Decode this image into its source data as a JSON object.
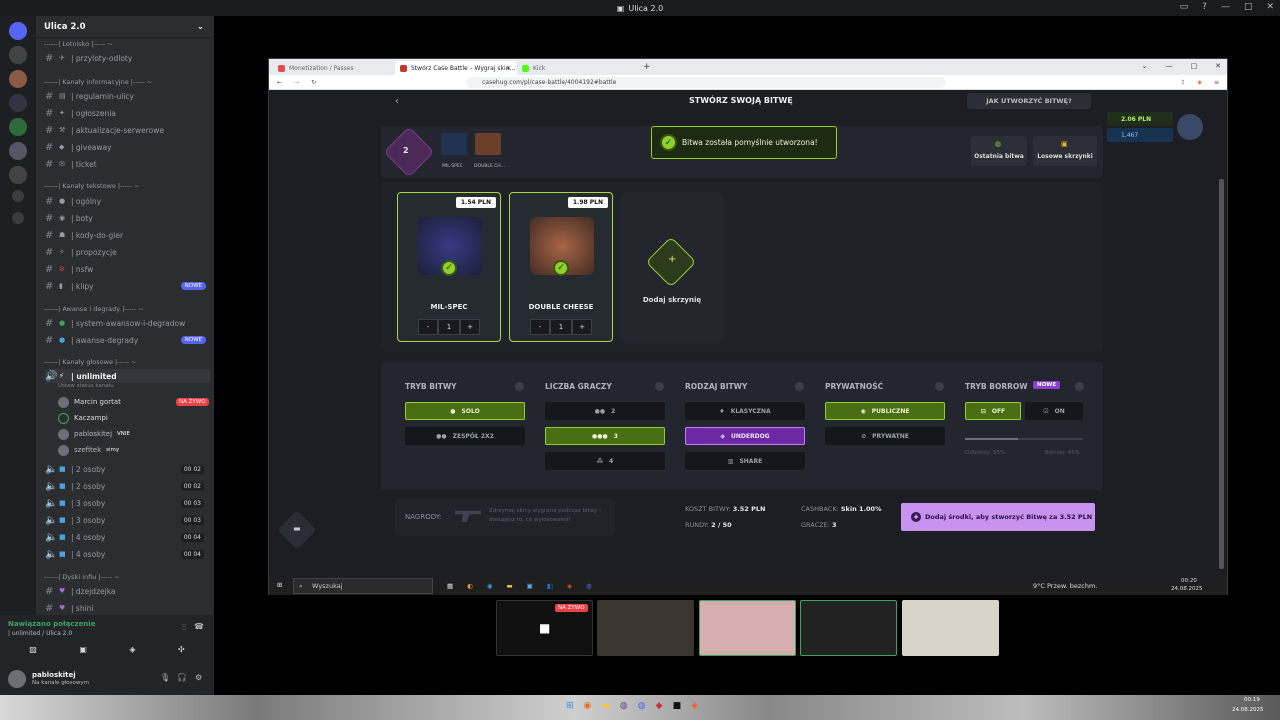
{
  "window": {
    "title": "Ulica 2.0"
  },
  "discord": {
    "server_name": "Ulica 2.0",
    "categories": [
      {
        "label": "------| Lotnisko |----- ~"
      },
      {
        "label": "------| Kanały informacyjne |----- ~"
      },
      {
        "label": "------| Kanały tekstowe |----- ~"
      },
      {
        "label": "------| Awanse i degrady |----- ~"
      },
      {
        "label": "------| Kanały głosowe |----- ~"
      },
      {
        "label": "------| Dyski infiu |----- ~"
      }
    ],
    "text_channels": [
      {
        "label": "| przyloty-odloty"
      },
      {
        "label": "| regulamin-ulicy"
      },
      {
        "label": "| ogłoszenia"
      },
      {
        "label": "| aktualizacje-serwerowe"
      },
      {
        "label": "| giveaway"
      },
      {
        "label": "| ticket"
      },
      {
        "label": "| ogólny"
      },
      {
        "label": "| boty"
      },
      {
        "label": "| kody-do-gier"
      },
      {
        "label": "| propozycje"
      },
      {
        "label": "| nsfw"
      },
      {
        "label": "| klipy",
        "badge": "NOWE"
      },
      {
        "label": "| system-awansow-i-degradow"
      },
      {
        "label": "| awanse-degrady",
        "badge": "NOWE"
      }
    ],
    "voice_active": {
      "label": "| unlimited",
      "status": "Ustaw status kanału"
    },
    "voice_users": [
      {
        "name": "Marcin gortat",
        "live": "NA ŻYWO"
      },
      {
        "name": "Kaczampi"
      },
      {
        "name": "pabloskitej",
        "tag": "VNIE"
      },
      {
        "name": "szefitek",
        "tag": "simy"
      }
    ],
    "voice_channels": [
      {
        "label": "| 2 osoby",
        "count": "00 02"
      },
      {
        "label": "| 2 osoby",
        "count": "00 02"
      },
      {
        "label": "| 3 osoby",
        "count": "00 03"
      },
      {
        "label": "| 3 osoby",
        "count": "00 03"
      },
      {
        "label": "| 4 osoby",
        "count": "00 04"
      },
      {
        "label": "| 4 osoby",
        "count": "00 04"
      }
    ],
    "bottom_channels": [
      {
        "label": "| dzejdzejka"
      },
      {
        "label": "| shini"
      }
    ],
    "connection": {
      "status": "Nawiązano połączenie",
      "channel": "| unlimited / Ulica 2.0"
    },
    "user": {
      "name": "pabloskitej",
      "status": "Na kanale głosowym"
    }
  },
  "browser": {
    "tabs": [
      {
        "label": "Monetization / Passes",
        "color": "#e34c4c"
      },
      {
        "label": "Stwórz Case Battle – Wygraj skin…",
        "color": "#c0392b"
      },
      {
        "label": "Kick",
        "color": "#53fc18"
      }
    ],
    "url": "casehug.com/pl/case-battle/4004192#battle"
  },
  "casehug": {
    "title": "STWÓRZ SWOJĄ BITWĘ",
    "help": "JAK UTWORZYĆ BITWĘ?",
    "balance": "2.06 PLN",
    "points": "1,467",
    "round_count": "2",
    "mini_cases": [
      "MIL-SPEC",
      "DOUBLE CH..."
    ],
    "toast": "Bitwa została pomyślnie utworzona!",
    "last_battle": "Ostatnia bitwa",
    "random_cases": "Losowe skrzynki",
    "cases": [
      {
        "name": "MIL-SPEC",
        "price": "1.54 PLN",
        "qty": "1"
      },
      {
        "name": "DOUBLE CHEESE",
        "price": "1.98 PLN",
        "qty": "1"
      }
    ],
    "add_case": "Dodaj skrzynię",
    "settings": {
      "mode": {
        "title": "TRYB BITWY",
        "options": [
          "SOLO",
          "ZESPÓŁ 2X2"
        ]
      },
      "players": {
        "title": "LICZBA GRACZY",
        "options": [
          "2",
          "3",
          "4"
        ]
      },
      "type": {
        "title": "RODZAJ BITWY",
        "options": [
          "KLASYCZNA",
          "UNDERDOG",
          "SHARE"
        ]
      },
      "privacy": {
        "title": "PRYWATNOŚĆ",
        "options": [
          "PUBLICZNE",
          "PRYWATNE"
        ]
      },
      "borrow": {
        "title": "TRYB BORROW",
        "badge": "NOWE",
        "options": [
          "OFF",
          "ON"
        ],
        "left": "Odbiorcy: 55%",
        "right": "Borrow: 45%"
      }
    },
    "footer": {
      "rewards_label": "NAGRODY:",
      "rewards_text": "Zdrzymaj skiny wygrane podczas bitwy - dostajesz to, co wylosowałeś!",
      "cost_label": "KOSZT BITWY:",
      "cost": "3.52 PLN",
      "rounds_label": "RUNDY:",
      "rounds": "2 / 50",
      "cashback_label": "CASHBACK:",
      "cashback": "Skin 1.00%",
      "players_label": "GRACZE:",
      "players": "3",
      "cta": "Dodaj środki, aby stworzyć Bitwę za 3.52 PLN"
    }
  },
  "inner_taskbar": {
    "search": "Wyszukaj",
    "weather": "9°C  Przew. bezchm.",
    "time": "00:20",
    "date": "24.08.2025"
  },
  "call": {
    "live": "NA ŻYWO"
  },
  "os_tray": {
    "time": "00:19",
    "date": "24.08.2025"
  }
}
